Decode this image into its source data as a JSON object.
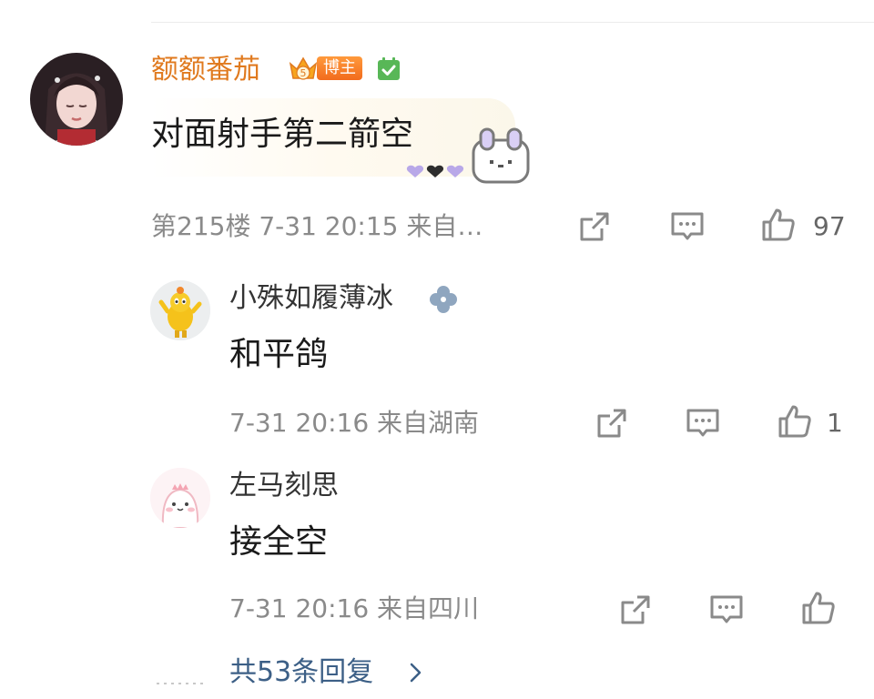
{
  "comment": {
    "author": "额额番茄",
    "badge_text": "博主",
    "crown_level": "5",
    "text": "对面射手第二箭空",
    "meta": "第215楼 7-31 20:15 来自…",
    "likes": "97"
  },
  "replies": [
    {
      "author": "小殊如履薄冰",
      "text": "和平鸽",
      "meta": "7-31 20:16 来自湖南",
      "likes": "1"
    },
    {
      "author": "左马刻思",
      "text": "接全空",
      "meta": "7-31 20:16 来自四川",
      "likes": ""
    }
  ],
  "more_replies": "共53条回复",
  "icons": {
    "share": "share-icon",
    "comment": "comment-icon",
    "like": "thumbs-up-icon",
    "verified": "verified-check-icon",
    "clover": "clover-icon",
    "expand": "chevron-right-icon"
  },
  "colors": {
    "author_name": "#e07a1f",
    "link": "#3c5f86",
    "meta": "#8a8a8a"
  }
}
